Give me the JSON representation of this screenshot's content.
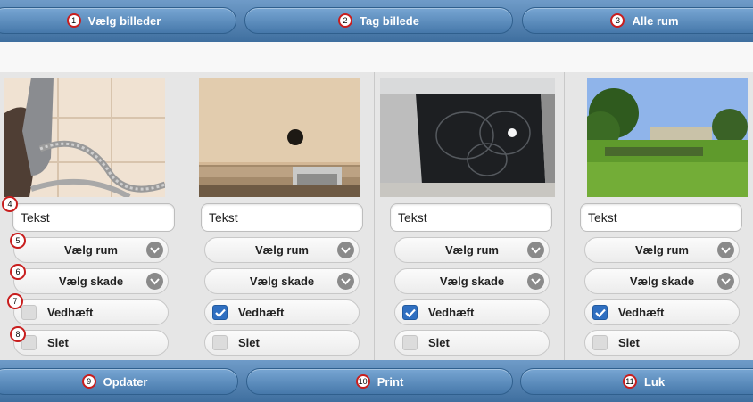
{
  "top_bar": {
    "buttons": [
      {
        "num": "1",
        "label": "Vælg billeder"
      },
      {
        "num": "2",
        "label": "Tag billede"
      },
      {
        "num": "3",
        "label": "Alle rum"
      }
    ]
  },
  "bottom_bar": {
    "buttons": [
      {
        "num": "9",
        "label": "Opdater"
      },
      {
        "num": "10",
        "label": "Print"
      },
      {
        "num": "11",
        "label": "Luk"
      }
    ]
  },
  "annotations": {
    "text": "4",
    "room": "5",
    "damage": "6",
    "attach": "7",
    "delete": "8"
  },
  "cards": [
    {
      "text_value": "Tekst",
      "room_label": "Vælg rum",
      "damage_label": "Vælg skade",
      "attach_label": "Vedhæft",
      "attach_checked": false,
      "delete_label": "Slet",
      "delete_checked": false,
      "photo": "shower-hose"
    },
    {
      "text_value": "Tekst",
      "room_label": "Vælg rum",
      "damage_label": "Vælg skade",
      "attach_label": "Vedhæft",
      "attach_checked": true,
      "delete_label": "Slet",
      "delete_checked": false,
      "photo": "drain"
    },
    {
      "text_value": "Tekst",
      "room_label": "Vælg rum",
      "damage_label": "Vælg skade",
      "attach_label": "Vedhæft",
      "attach_checked": true,
      "delete_label": "Slet",
      "delete_checked": false,
      "photo": "ceramic-hob"
    },
    {
      "text_value": "Tekst",
      "room_label": "Vælg rum",
      "damage_label": "Vælg skade",
      "attach_label": "Vedhæft",
      "attach_checked": true,
      "delete_label": "Slet",
      "delete_checked": false,
      "photo": "park"
    }
  ],
  "colors": {
    "bar": "#4a7bad",
    "checkbox": "#2f6fc1",
    "badge_ring": "#c81e1e"
  }
}
